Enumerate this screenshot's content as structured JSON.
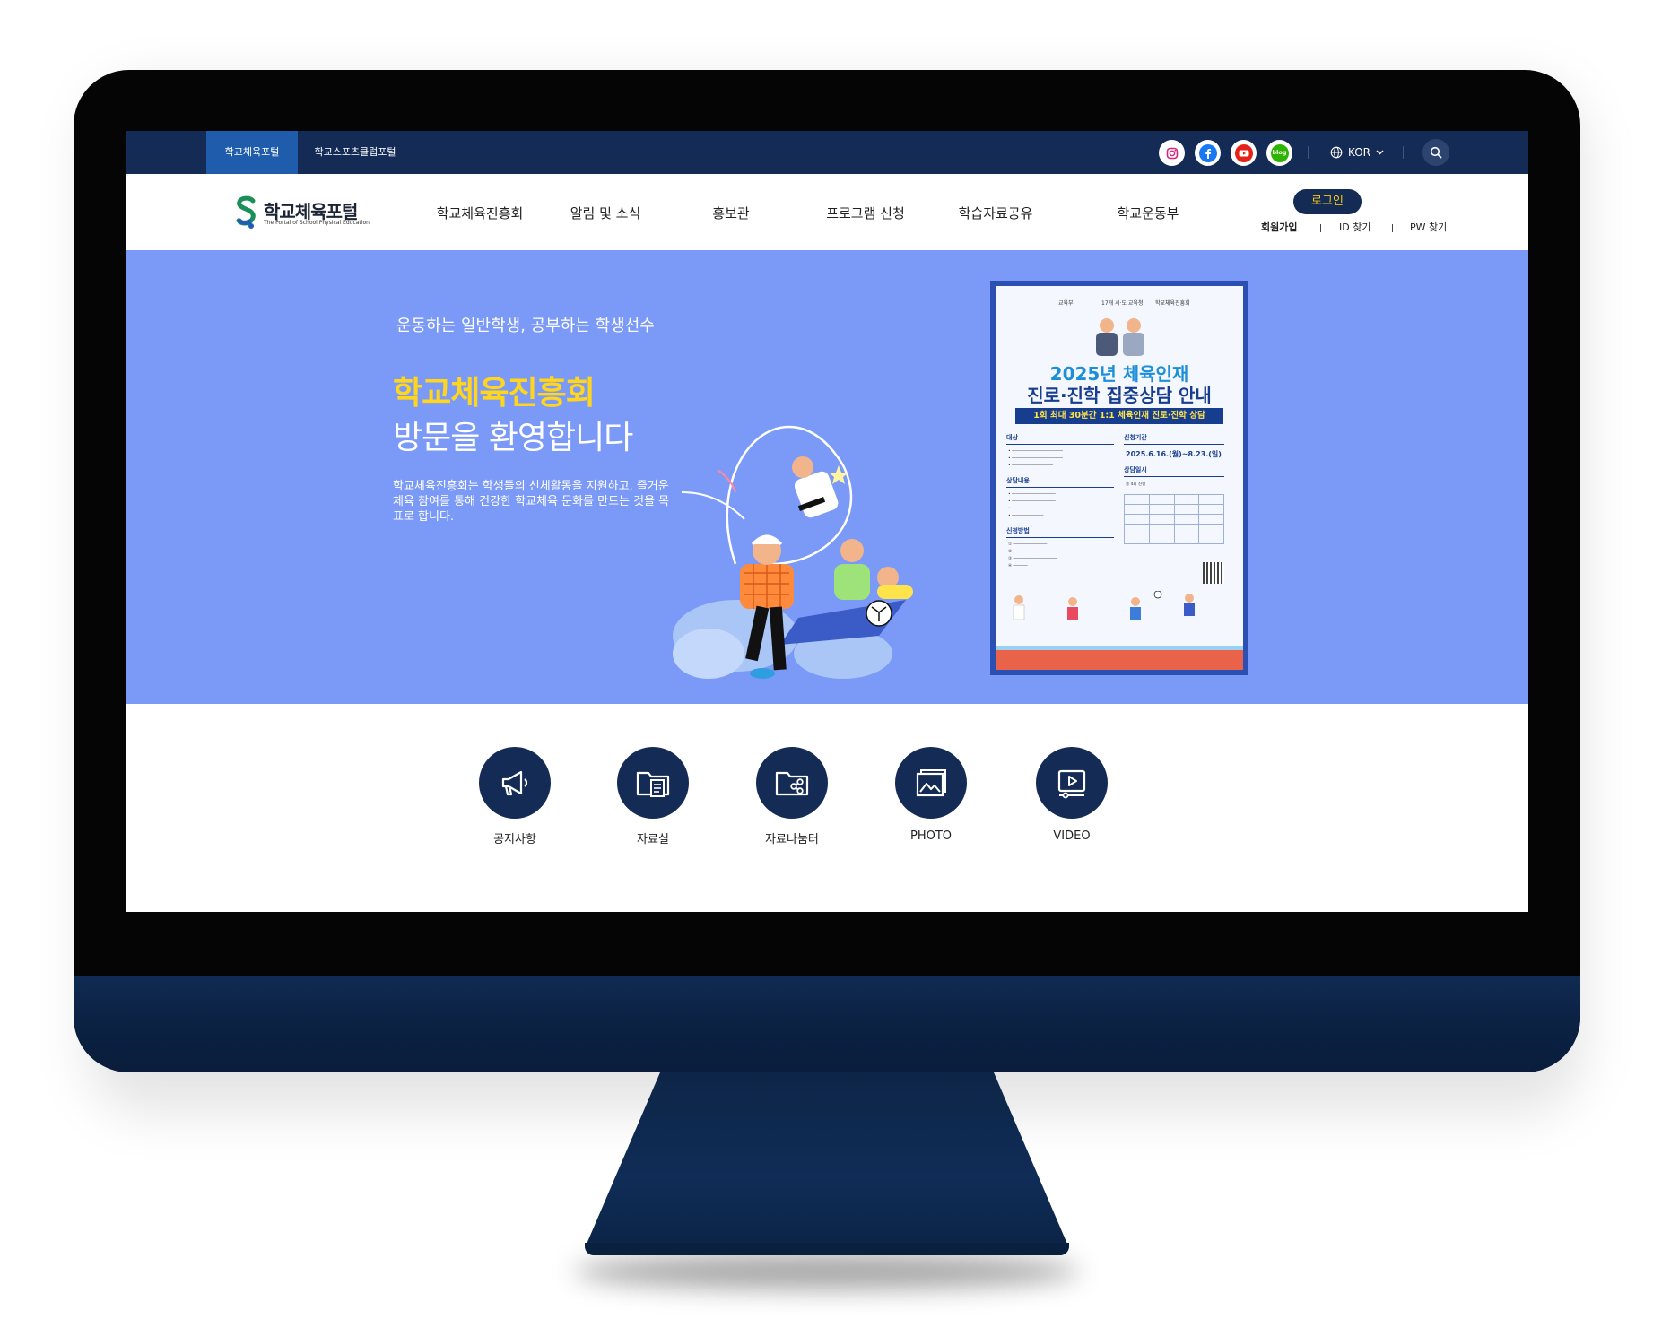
{
  "utility_bar": {
    "tabs": [
      "학교체육포털",
      "학교스포츠클럽포털"
    ],
    "socials": [
      "instagram-icon",
      "facebook-icon",
      "youtube-icon",
      "blog-icon"
    ],
    "blog_label": "blog",
    "language": "KOR"
  },
  "header": {
    "logo_title": "학교체육포털",
    "logo_subtitle": "The Portal of School Physical Education",
    "nav": [
      "학교체육진흥회",
      "알림 및 소식",
      "홍보관",
      "프로그램 신청",
      "학습자료공유",
      "학교운동부"
    ],
    "login_label": "로그인",
    "member_links": [
      "회원가입",
      "ID 찾기",
      "PW 찾기"
    ]
  },
  "hero": {
    "eyebrow": "운동하는 일반학생, 공부하는 학생선수",
    "title_highlight": "학교체육진흥회",
    "title_rest": "방문을 환영합니다",
    "description": "학교체육진흥회는 학생들의 신체활동을 지원하고, 즐거운 체육 참여를 통해 건강한 학교체육 문화를 만드는 것을 목표로 합니다.",
    "background_color": "#7b9af7",
    "highlight_color": "#ffd51e"
  },
  "poster": {
    "orgs": [
      "교육부",
      "17개 시·도 교육청",
      "학교체육진흥회"
    ],
    "headline_line1": "2025년 체육인재",
    "headline_line2": "진로·진학 집중상담 안내",
    "banner": "1회 최대 30분간 1:1 체육인재 진로·진학 상담",
    "section_target": "대상",
    "section_content": "상담내용",
    "section_method": "신청방법",
    "section_period": "신청기간",
    "section_schedule": "상담일시",
    "period_value": "2025.6.16.(월)~8.23.(일)",
    "schedule_note": "총 4회 진행"
  },
  "quicklinks": [
    {
      "label": "공지사항",
      "icon": "megaphone-icon"
    },
    {
      "label": "자료실",
      "icon": "folder-document-icon"
    },
    {
      "label": "자료나눔터",
      "icon": "folder-share-icon"
    },
    {
      "label": "PHOTO",
      "icon": "photo-gallery-icon"
    },
    {
      "label": "VIDEO",
      "icon": "video-play-icon"
    }
  ],
  "colors": {
    "navy": "#142b55",
    "active_tab": "#1f5cab",
    "login_text": "#f5c518"
  }
}
